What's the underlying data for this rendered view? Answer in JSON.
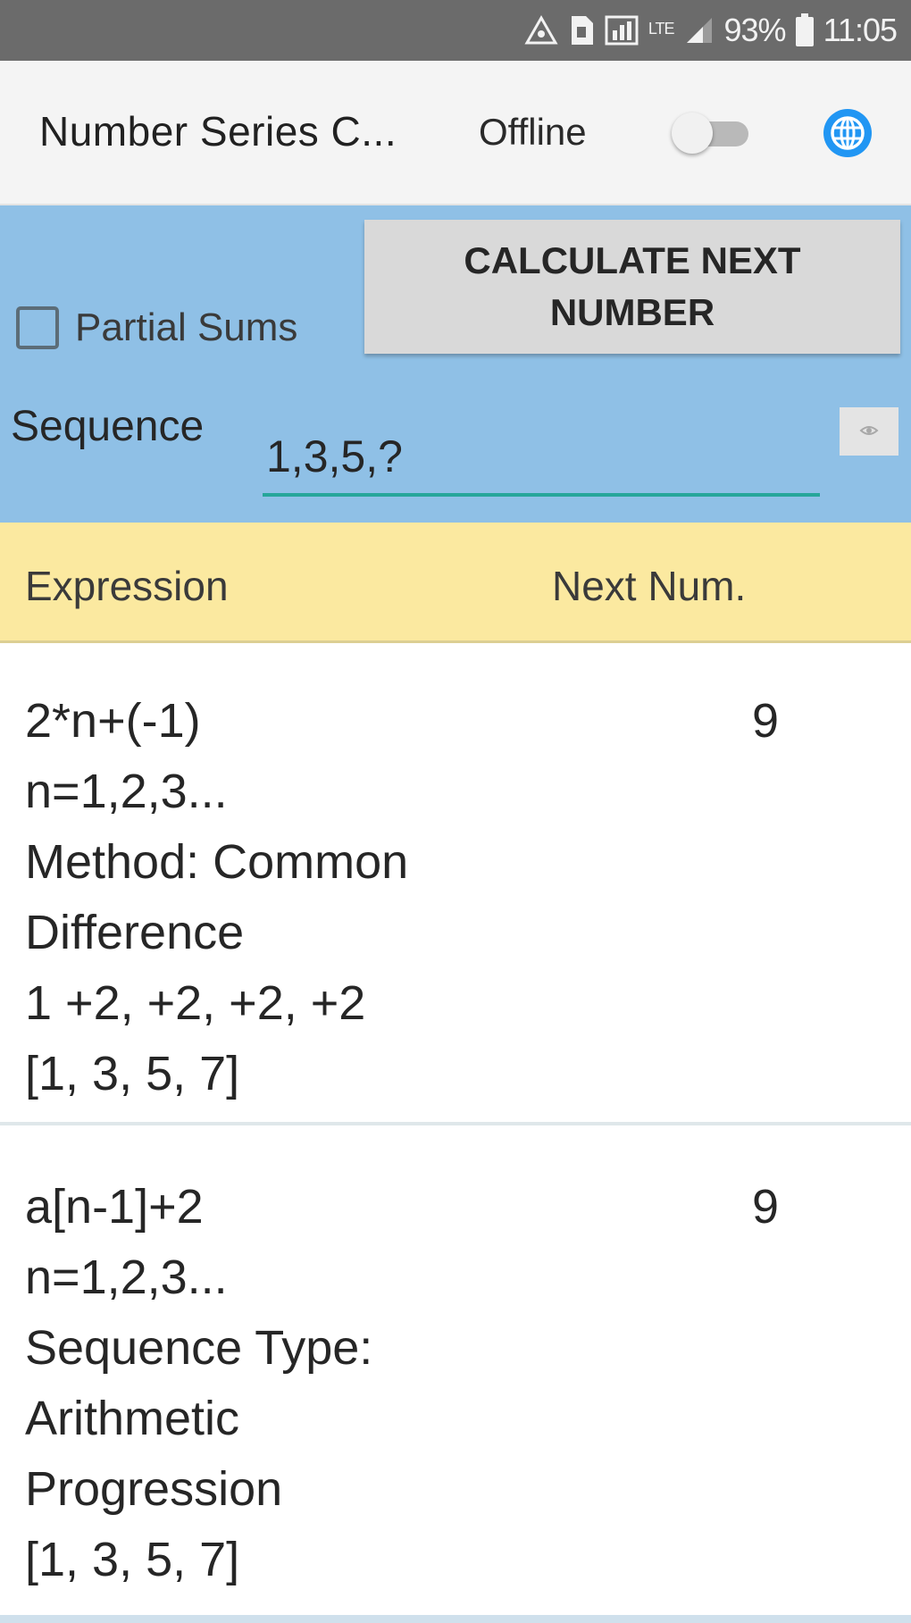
{
  "status_bar": {
    "battery": "93%",
    "time": "11:05",
    "network_label": "LTE"
  },
  "action_bar": {
    "title": "Number Series C...",
    "offline_label": "Offline",
    "offline_toggle_on": false,
    "accent_color": "#2196f3"
  },
  "input_panel": {
    "partial_sums_label": "Partial Sums",
    "partial_sums_checked": false,
    "calculate_button_label": "CALCULATE NEXT NUMBER",
    "sequence_label": "Sequence",
    "sequence_value": "1,3,5,?",
    "panel_color": "#8fc0e6"
  },
  "results_header": {
    "expression_label": "Expression",
    "next_label": "Next Num.",
    "header_color": "#fbe9a0"
  },
  "results": [
    {
      "lines": [
        "2*n+(-1)",
        "n=1,2,3...",
        "Method: Common",
        "Difference",
        "1 +2, +2, +2, +2",
        "[1, 3, 5, 7]"
      ],
      "next": "9"
    },
    {
      "lines": [
        "a[n-1]+2",
        "n=1,2,3...",
        "Sequence Type:",
        "Arithmetic",
        "Progression",
        "[1, 3, 5, 7]"
      ],
      "next": "9"
    }
  ]
}
